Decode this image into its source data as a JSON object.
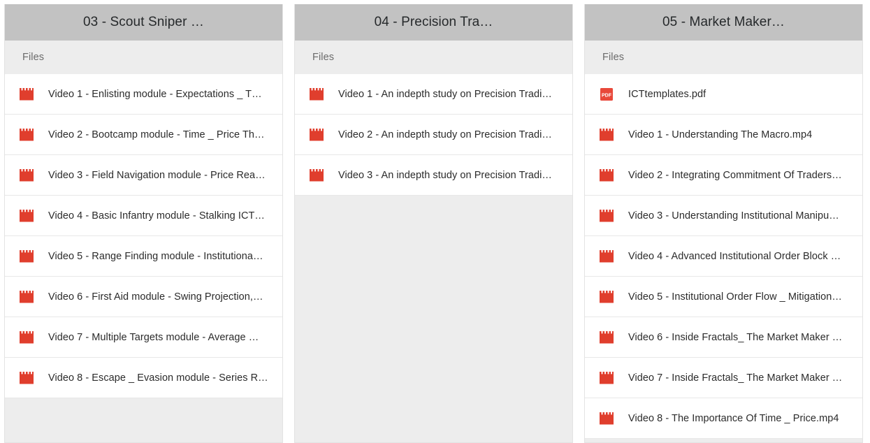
{
  "colors": {
    "column_header_bg": "#c2c2c2",
    "column_bg": "#ededed",
    "row_bg": "#ffffff",
    "row_divider": "#e8e8e8",
    "title_text": "#26292b",
    "file_text": "#2b2b2b",
    "section_label_text": "#6b6b6b",
    "video_icon_red": "#e03e2d",
    "pdf_icon_red": "#e8483a"
  },
  "columns": [
    {
      "title": "03 - Scout Sniper …",
      "section_label": "Files",
      "files": [
        {
          "icon": "video-file-icon",
          "name": "Video 1 - Enlisting module - Expectations _ T…"
        },
        {
          "icon": "video-file-icon",
          "name": "Video 2 - Bootcamp module - Time _ Price Th…"
        },
        {
          "icon": "video-file-icon",
          "name": "Video 3 - Field Navigation module - Price Rea…"
        },
        {
          "icon": "video-file-icon",
          "name": "Video 4 - Basic Infantry module - Stalking ICT…"
        },
        {
          "icon": "video-file-icon",
          "name": "Video 5 - Range Finding module - Institutiona…"
        },
        {
          "icon": "video-file-icon",
          "name": "Video 6 - First Aid module - Swing Projection,…"
        },
        {
          "icon": "video-file-icon",
          "name": "Video 7 - Multiple Targets module - Average …"
        },
        {
          "icon": "video-file-icon",
          "name": "Video 8 - Escape _ Evasion module - Series R…"
        }
      ]
    },
    {
      "title": "04 - Precision Tra…",
      "section_label": "Files",
      "files": [
        {
          "icon": "video-file-icon",
          "name": "Video 1 - An indepth study on Precision Tradi…"
        },
        {
          "icon": "video-file-icon",
          "name": "Video 2 - An indepth study on Precision Tradi…"
        },
        {
          "icon": "video-file-icon",
          "name": "Video 3 - An indepth study on Precision Tradi…"
        }
      ]
    },
    {
      "title": "05 - Market Maker…",
      "section_label": "Files",
      "files": [
        {
          "icon": "pdf-file-icon",
          "name": "ICTtemplates.pdf"
        },
        {
          "icon": "video-file-icon",
          "name": "Video 1 - Understanding The Macro.mp4"
        },
        {
          "icon": "video-file-icon",
          "name": "Video 2 - Integrating Commitment Of Traders…"
        },
        {
          "icon": "video-file-icon",
          "name": "Video 3 - Understanding Institutional Manipu…"
        },
        {
          "icon": "video-file-icon",
          "name": "Video 4 - Advanced Institutional Order Block …"
        },
        {
          "icon": "video-file-icon",
          "name": "Video 5 - Institutional Order Flow _ Mitigation…"
        },
        {
          "icon": "video-file-icon",
          "name": "Video 6 - Inside Fractals_ The Market Maker …"
        },
        {
          "icon": "video-file-icon",
          "name": "Video 7 - Inside Fractals_ The Market Maker …"
        },
        {
          "icon": "video-file-icon",
          "name": "Video 8 - The Importance Of Time _ Price.mp4"
        }
      ]
    }
  ]
}
